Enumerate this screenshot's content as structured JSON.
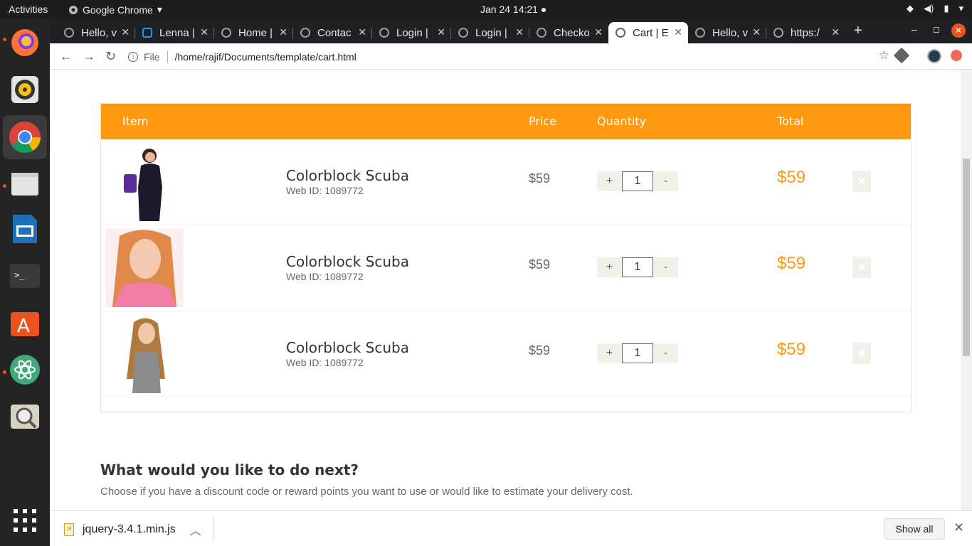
{
  "system": {
    "activities": "Activities",
    "app_name": "Google Chrome",
    "clock": "Jan 24  14:21 ●"
  },
  "tabs": [
    {
      "label": "Hello, v"
    },
    {
      "label": "Lenna |"
    },
    {
      "label": "Home |"
    },
    {
      "label": "Contac"
    },
    {
      "label": "Login |"
    },
    {
      "label": "Login |"
    },
    {
      "label": "Checko"
    },
    {
      "label": "Cart | E"
    },
    {
      "label": "Hello, v"
    },
    {
      "label": "https:/"
    }
  ],
  "address": {
    "scheme": "File",
    "url": "/home/rajif/Documents/template/cart.html"
  },
  "cart": {
    "headers": {
      "item": "Item",
      "price": "Price",
      "quantity": "Quantity",
      "total": "Total"
    },
    "rows": [
      {
        "name": "Colorblock Scuba",
        "webid": "Web ID: 1089772",
        "price": "$59",
        "qty": "1",
        "total": "$59",
        "plus": "+",
        "minus": "-"
      },
      {
        "name": "Colorblock Scuba",
        "webid": "Web ID: 1089772",
        "price": "$59",
        "qty": "1",
        "total": "$59",
        "plus": "+",
        "minus": "-"
      },
      {
        "name": "Colorblock Scuba",
        "webid": "Web ID: 1089772",
        "price": "$59",
        "qty": "1",
        "total": "$59",
        "plus": "+",
        "minus": "-"
      }
    ]
  },
  "next": {
    "title": "What would you like to do next?",
    "desc": "Choose if you have a discount code or reward points you want to use or would like to estimate your delivery cost."
  },
  "download": {
    "filename": "jquery-3.4.1.min.js",
    "show_all": "Show all"
  },
  "colors": {
    "accent": "#fe980f"
  }
}
